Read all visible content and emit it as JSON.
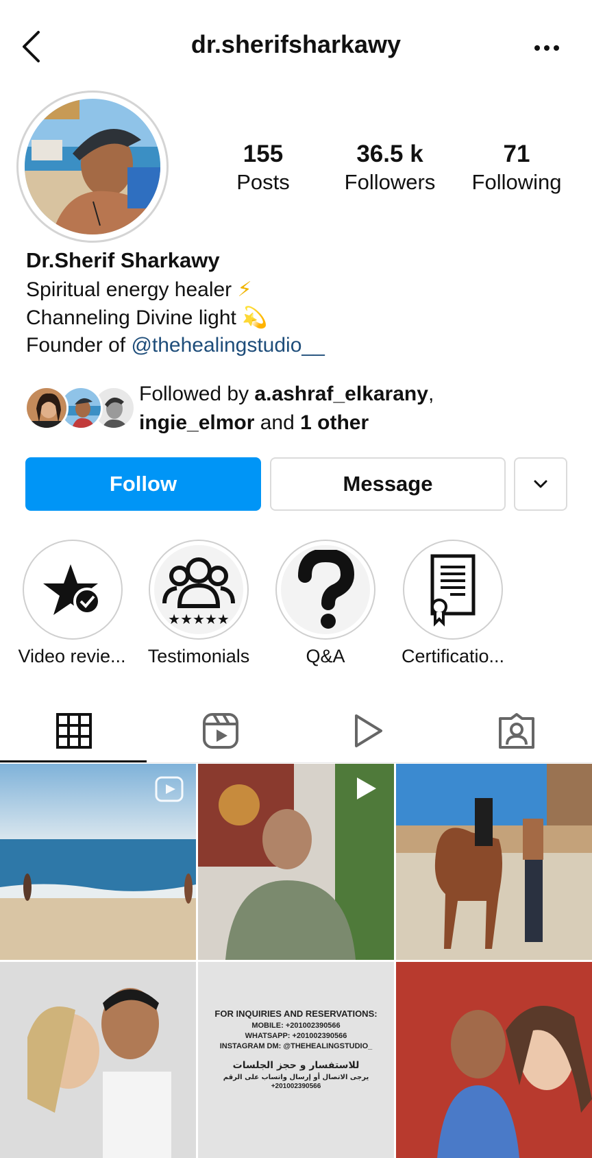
{
  "header": {
    "username": "dr.sherifsharkawy"
  },
  "stats": [
    {
      "value": "155",
      "label": "Posts"
    },
    {
      "value": "36.5 k",
      "label": "Followers"
    },
    {
      "value": "71",
      "label": "Following"
    }
  ],
  "profile": {
    "name": "Dr.Sherif Sharkawy",
    "bio_line1": "Spiritual energy healer",
    "bio_line1_emoji": "⚡",
    "bio_line2": "Channeling Divine light",
    "bio_line2_emoji": "💫",
    "bio_line3_prefix": "Founder of ",
    "bio_line3_link": "@thehealingstudio__"
  },
  "followed_by": {
    "prefix": "Followed by ",
    "user1": "a.ashraf_elkarany",
    "sep": ",",
    "user2": "ingie_elmor",
    "mid": " and ",
    "others": "1 other"
  },
  "buttons": {
    "follow": "Follow",
    "message": "Message"
  },
  "highlights": [
    {
      "label": "Video revie...",
      "icon": "star-check-icon"
    },
    {
      "label": "Testimonials",
      "icon": "people-stars-icon"
    },
    {
      "label": "Q&A",
      "icon": "question-mark-icon"
    },
    {
      "label": "Certificatio...",
      "icon": "certificate-icon"
    }
  ],
  "tabs": [
    {
      "icon": "grid-icon",
      "active": true
    },
    {
      "icon": "reels-icon",
      "active": false
    },
    {
      "icon": "play-icon",
      "active": false
    },
    {
      "icon": "tagged-icon",
      "active": false
    }
  ],
  "posts": {
    "info_card": {
      "line1": "FOR INQUIRIES AND RESERVATIONS:",
      "line2": "MOBILE: +201002390566",
      "line3": "WHATSAPP: +201002390566",
      "line4": "INSTAGRAM DM: @THEHEALINGSTUDIO_",
      "arabic1": "للاستفسار و حجز الجلسات",
      "arabic2": "يرجى الاتصال أو إرسال واتساب على الرقم",
      "arabic3": "+201002390566"
    }
  },
  "colors": {
    "accent": "#0095f6",
    "link": "#1e4d7a"
  }
}
